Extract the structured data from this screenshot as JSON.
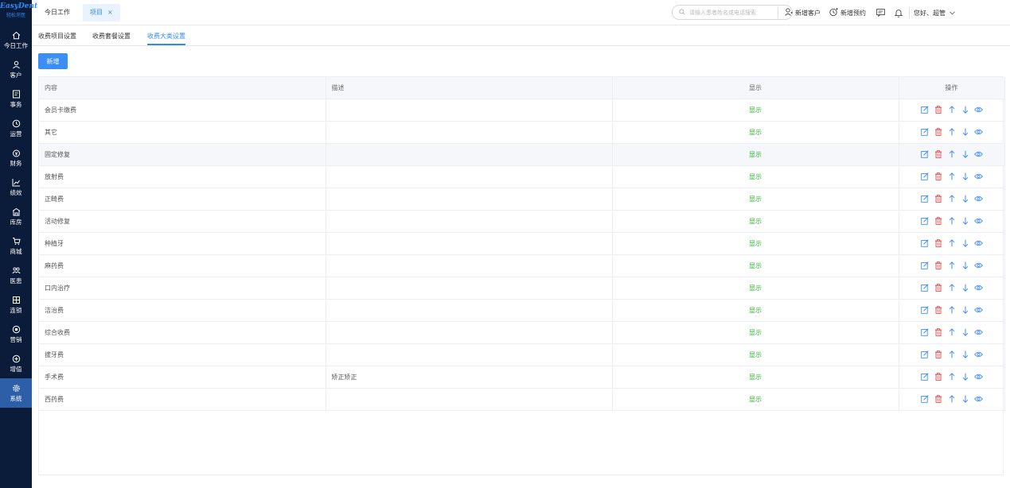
{
  "app": {
    "brand": "EasyDent",
    "brand_sub": "轻松牙医"
  },
  "sidebar": {
    "items": [
      {
        "label": "今日工作",
        "icon": "home-icon"
      },
      {
        "label": "客户",
        "icon": "customer-icon"
      },
      {
        "label": "事务",
        "icon": "task-icon"
      },
      {
        "label": "运营",
        "icon": "clock-icon"
      },
      {
        "label": "财务",
        "icon": "finance-icon"
      },
      {
        "label": "绩效",
        "icon": "chart-icon"
      },
      {
        "label": "库房",
        "icon": "warehouse-icon"
      },
      {
        "label": "商城",
        "icon": "cart-icon"
      },
      {
        "label": "医患",
        "icon": "doctor-patient-icon"
      },
      {
        "label": "连锁",
        "icon": "chain-icon"
      },
      {
        "label": "营销",
        "icon": "marketing-icon"
      },
      {
        "label": "增值",
        "icon": "value-added-icon"
      },
      {
        "label": "系统",
        "icon": "settings-icon"
      }
    ],
    "active_index": 12
  },
  "topbar": {
    "tab_today": "今日工作",
    "tab_project": "项目",
    "tab_close": "×",
    "search_placeholder": "请输入患者姓名或电话搜索",
    "new_customer": "新增客户",
    "new_appointment": "新增预约",
    "greeting": "您好、超管"
  },
  "subtabs": [
    "收费项目设置",
    "收费套餐设置",
    "收费大类设置"
  ],
  "subtab_active": 2,
  "toolbar": {
    "new_label": "新增"
  },
  "table": {
    "headers": [
      "内容",
      "描述",
      "显示",
      "操作"
    ],
    "rows": [
      {
        "content": "会员卡缴费",
        "desc": "",
        "show": "显示"
      },
      {
        "content": "其它",
        "desc": "",
        "show": "显示"
      },
      {
        "content": "固定修复",
        "desc": "",
        "show": "显示"
      },
      {
        "content": "放射费",
        "desc": "",
        "show": "显示"
      },
      {
        "content": "正畸费",
        "desc": "",
        "show": "显示"
      },
      {
        "content": "活动修复",
        "desc": "",
        "show": "显示"
      },
      {
        "content": "种植牙",
        "desc": "",
        "show": "显示"
      },
      {
        "content": "麻药费",
        "desc": "",
        "show": "显示"
      },
      {
        "content": "口内治疗",
        "desc": "",
        "show": "显示"
      },
      {
        "content": "洁治费",
        "desc": "",
        "show": "显示"
      },
      {
        "content": "综合收费",
        "desc": "",
        "show": "显示"
      },
      {
        "content": "拔牙费",
        "desc": "",
        "show": "显示"
      },
      {
        "content": "手术费",
        "desc": "矫正矫正",
        "show": "显示"
      },
      {
        "content": "西药费",
        "desc": "",
        "show": "显示"
      }
    ],
    "highlight_row": 2
  },
  "colors": {
    "accent": "#2f8cf5",
    "sidebar_bg": "#0b1b3a",
    "show_green": "#2ab32a",
    "delete_red": "#e84c4c"
  }
}
